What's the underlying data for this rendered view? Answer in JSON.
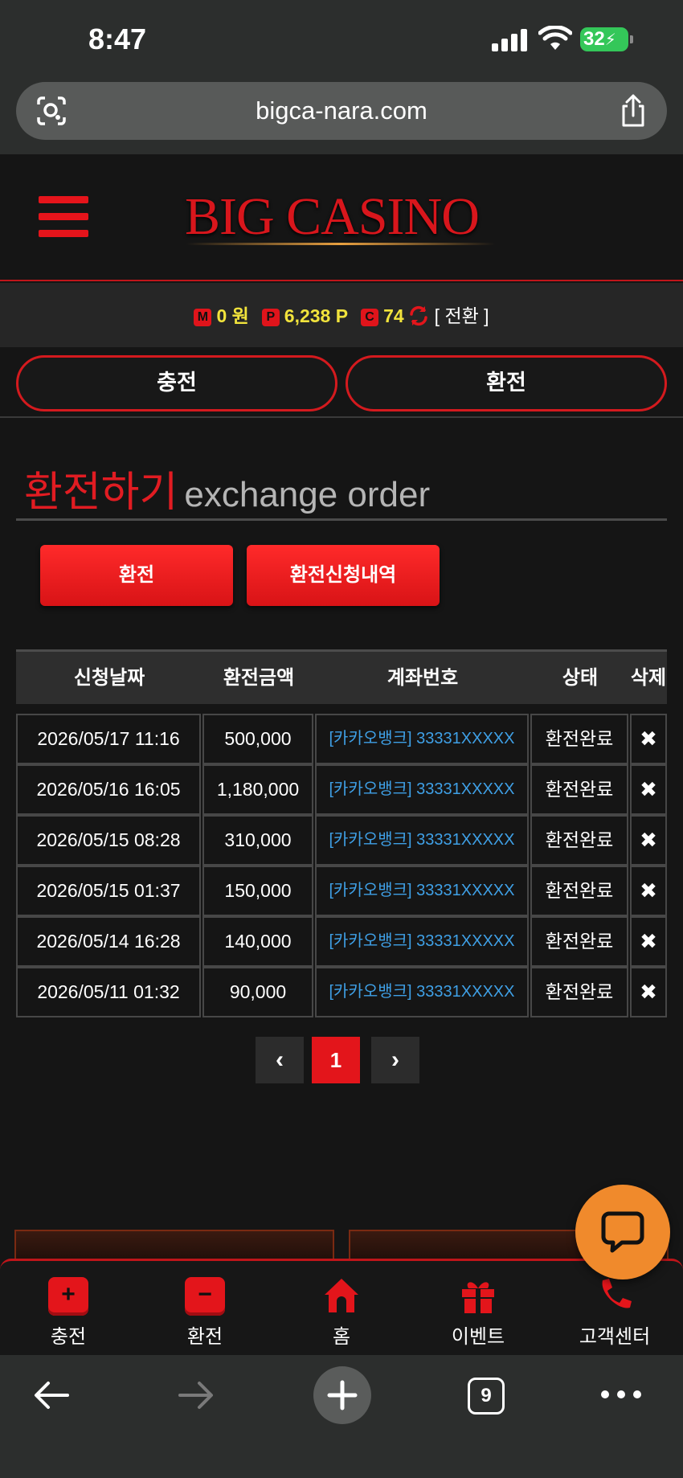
{
  "status_bar": {
    "time": "8:47",
    "battery": "32"
  },
  "browser": {
    "url": "bigca-nara.com",
    "tab_count": "9"
  },
  "header": {
    "logo": "BIG CASINO"
  },
  "balance": {
    "money_badge": "M",
    "money": "0 원",
    "point_badge": "P",
    "points": "6,238 P",
    "comp_badge": "C",
    "comp": "74",
    "switch_label": "[ 전환 ]"
  },
  "top_buttons": {
    "deposit": "충전",
    "withdraw": "환전"
  },
  "section": {
    "title": "환전하기",
    "subtitle": "exchange order"
  },
  "action_buttons": {
    "exchange": "환전",
    "history": "환전신청내역"
  },
  "table": {
    "headers": [
      "신청날짜",
      "환전금액",
      "계좌번호",
      "상태",
      "삭제"
    ],
    "rows": [
      {
        "date": "2026/05/17 11:16",
        "amount": "500,000",
        "account": "[카카오뱅크] 33331XXXXX",
        "status": "환전완료",
        "delete": "✖"
      },
      {
        "date": "2026/05/16 16:05",
        "amount": "1,180,000",
        "account": "[카카오뱅크] 33331XXXXX",
        "status": "환전완료",
        "delete": "✖"
      },
      {
        "date": "2026/05/15 08:28",
        "amount": "310,000",
        "account": "[카카오뱅크] 33331XXXXX",
        "status": "환전완료",
        "delete": "✖"
      },
      {
        "date": "2026/05/15 01:37",
        "amount": "150,000",
        "account": "[카카오뱅크] 33331XXXXX",
        "status": "환전완료",
        "delete": "✖"
      },
      {
        "date": "2026/05/14 16:28",
        "amount": "140,000",
        "account": "[카카오뱅크] 33331XXXXX",
        "status": "환전완료",
        "delete": "✖"
      },
      {
        "date": "2026/05/11 01:32",
        "amount": "90,000",
        "account": "[카카오뱅크] 33331XXXXX",
        "status": "환전완료",
        "delete": "✖"
      }
    ]
  },
  "pagination": {
    "prev": "‹",
    "current": "1",
    "next": "›"
  },
  "bottom_nav": {
    "items": [
      {
        "label": "충전",
        "icon": "plus-icon"
      },
      {
        "label": "환전",
        "icon": "minus-icon"
      },
      {
        "label": "홈",
        "icon": "home-icon"
      },
      {
        "label": "이벤트",
        "icon": "gift-icon"
      },
      {
        "label": "고객센터",
        "icon": "phone-icon"
      }
    ]
  },
  "colors": {
    "accent": "#e3151b",
    "points": "#f1e33c",
    "link": "#3fa0e6",
    "chat": "#f08a2c"
  }
}
